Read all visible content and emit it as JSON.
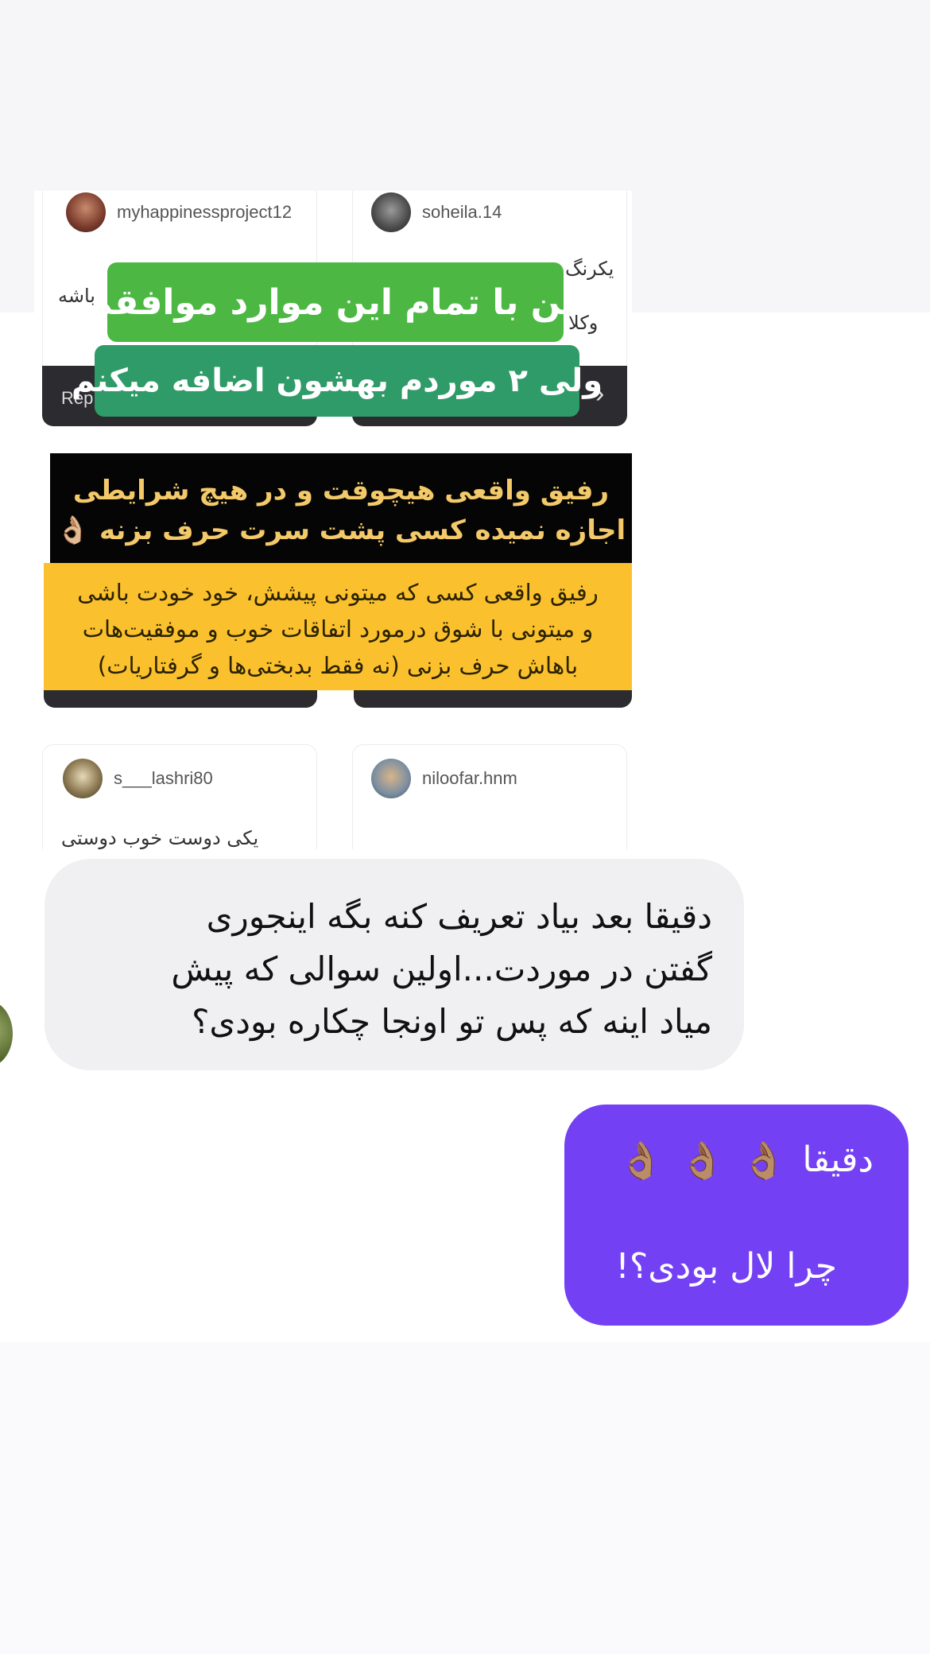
{
  "shared_image": {
    "cards_top": [
      {
        "username": "myhappinessproject12",
        "text": "باشه",
        "strip_label": "Rep"
      },
      {
        "username": "soheila.14",
        "text": "یکرنگ",
        "text2": "وکلا",
        "strip_label": "›"
      }
    ],
    "green_sticker": {
      "line1": "من با تمام این موارد موافقم",
      "line2": "ولی ۲ موردم بهشون اضافه میکنم"
    },
    "black_box": {
      "line1": "رفیق واقعی هیچوقت و در هیچ شرایطی",
      "line2": "اجازه نمیده کسی پشت سرت حرف بزنه 👌🏼"
    },
    "yellow_box": {
      "line1": "رفیق واقعی کسی که میتونی پیشش، خود خودت باشی",
      "line2": "و میتونی با شوق درمورد اتفاقات خوب و موفقیت‌هات",
      "line3": "باهاش حرف بزنی (نه فقط بدبختی‌ها و گرفتاریات)"
    },
    "cards_bottom": [
      {
        "username": "s___lashri80",
        "text": "یکی دوست خوب دوستی"
      },
      {
        "username": "niloofar.hnm",
        "text": ""
      }
    ]
  },
  "incoming_message": {
    "line1": "دقیقا بعد بیاد تعریف کنه بگه اینجوری",
    "line2": "گفتن در موردت...اولین سوالی که پیش",
    "line3": "میاد اینه که پس تو اونجا چکاره بودی؟"
  },
  "outgoing_message": {
    "line1": "دقیقا",
    "emoji": "👌🏽",
    "line2": "چرا لال بودی؟!"
  },
  "colors": {
    "outgoing_bubble": "#7341f3",
    "incoming_bubble": "#f0f0f2",
    "green_sticker": "#4cb843",
    "teal_sticker": "#2e9b68",
    "yellow_box": "#fbc02d"
  }
}
